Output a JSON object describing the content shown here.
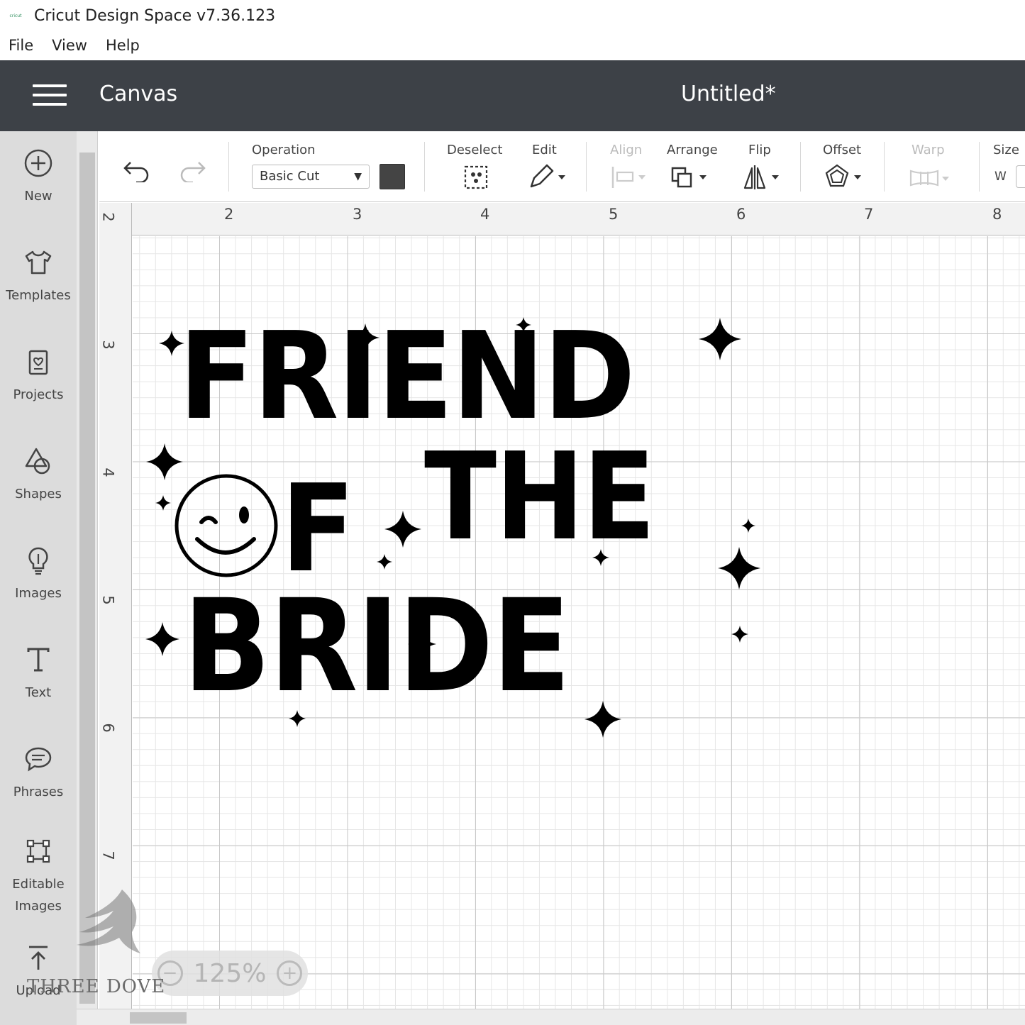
{
  "app": {
    "title": "Cricut Design Space  v7.36.123",
    "logo_text": "cricut"
  },
  "menu": [
    "File",
    "View",
    "Help"
  ],
  "header": {
    "section": "Canvas",
    "document_title": "Untitled*"
  },
  "sidebar": {
    "items": [
      {
        "label": "New",
        "icon": "plus-circle-icon"
      },
      {
        "label": "Templates",
        "icon": "tshirt-icon"
      },
      {
        "label": "Projects",
        "icon": "projects-icon"
      },
      {
        "label": "Shapes",
        "icon": "shapes-icon"
      },
      {
        "label": "Images",
        "icon": "lightbulb-icon"
      },
      {
        "label": "Text",
        "icon": "text-icon"
      },
      {
        "label": "Phrases",
        "icon": "speech-bubble-icon"
      },
      {
        "label": "Editable\nImages",
        "icon": "editable-images-icon"
      },
      {
        "label": "Upload",
        "icon": "upload-icon"
      }
    ]
  },
  "toolbar": {
    "operation_label": "Operation",
    "operation_value": "Basic Cut",
    "deselect_label": "Deselect",
    "edit_label": "Edit",
    "align_label": "Align",
    "arrange_label": "Arrange",
    "flip_label": "Flip",
    "offset_label": "Offset",
    "warp_label": "Warp",
    "size_label": "Size",
    "size_w_label": "W",
    "color": "#444444"
  },
  "ruler": {
    "top": [
      "2",
      "3",
      "4",
      "5",
      "6",
      "7",
      "8"
    ],
    "left": [
      "2",
      "3",
      "4",
      "5",
      "6",
      "7"
    ]
  },
  "design": {
    "line1": "FRIEND",
    "line2_of": "F",
    "line2_the": "THE",
    "line3": "BRIDE"
  },
  "zoom": {
    "value": "125%",
    "minus": "−",
    "plus": "+"
  },
  "watermark": "THREE DOVE"
}
